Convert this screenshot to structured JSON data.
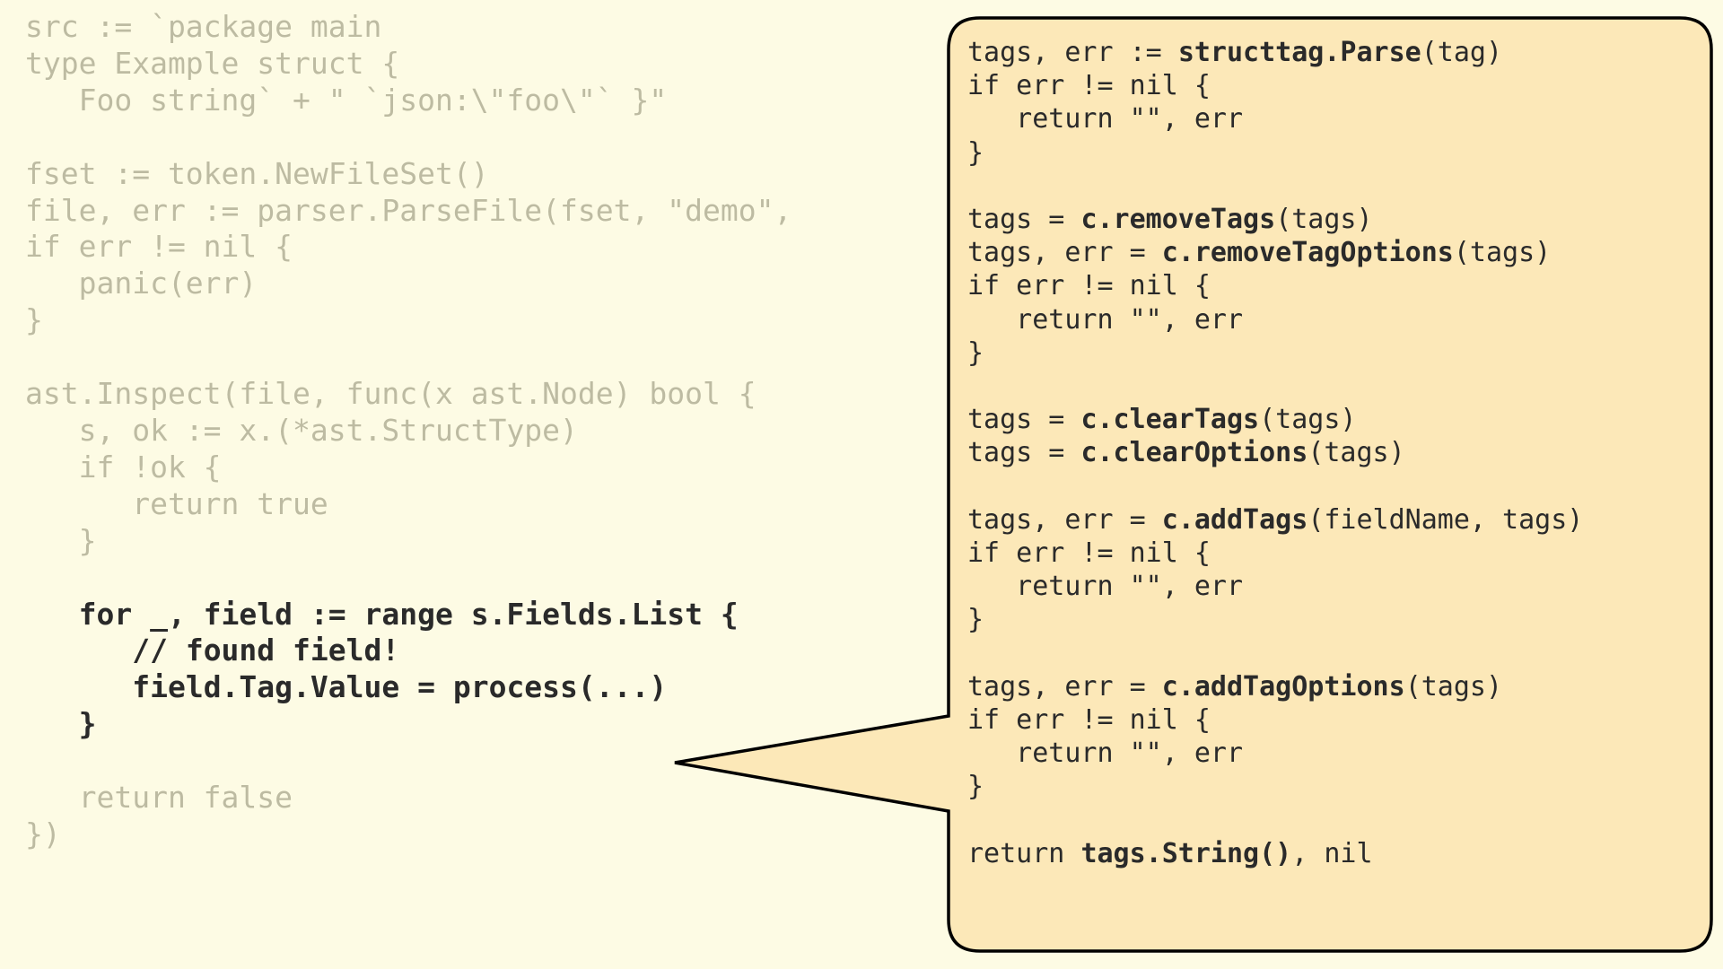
{
  "left": {
    "l01": "src := `package main",
    "l02": "type Example struct {",
    "l03": "   Foo string` + \" `json:\\\"foo\\\"` }\"",
    "l04": "",
    "l05": "fset := token.NewFileSet()",
    "l06": "file, err := parser.ParseFile(fset, \"demo\",",
    "l07": "if err != nil {",
    "l08": "   panic(err)",
    "l09": "}",
    "l10": "",
    "l11": "ast.Inspect(file, func(x ast.Node) bool {",
    "l12": "   s, ok := x.(*ast.StructType)",
    "l13": "   if !ok {",
    "l14": "      return true",
    "l15": "   }",
    "l16": "",
    "l17_pre": "   ",
    "l17_hl": "for _, field := range s.Fields.List {",
    "l18_pre": "      ",
    "l18_hl": "// found field!",
    "l19_pre": "      ",
    "l19_hl": "field.Tag.Value = process(...)",
    "l20_pre": "   ",
    "l20_hl": "}",
    "l21": "",
    "l22": "   return false",
    "l23": "})"
  },
  "right": {
    "r01a": "tags, err := ",
    "r01b": "structtag.Parse",
    "r01c": "(tag)",
    "r02": "if err != nil {",
    "r03": "   return \"\", err",
    "r04": "}",
    "r05": "",
    "r06a": "tags = ",
    "r06b": "c.removeTags",
    "r06c": "(tags)",
    "r07a": "tags, err = ",
    "r07b": "c.removeTagOptions",
    "r07c": "(tags)",
    "r08": "if err != nil {",
    "r09": "   return \"\", err",
    "r10": "}",
    "r11": "",
    "r12a": "tags = ",
    "r12b": "c.clearTags",
    "r12c": "(tags)",
    "r13a": "tags = ",
    "r13b": "c.clearOptions",
    "r13c": "(tags)",
    "r14": "",
    "r15a": "tags, err = ",
    "r15b": "c.addTags",
    "r15c": "(fieldName, tags)",
    "r16": "if err != nil {",
    "r17": "   return \"\", err",
    "r18": "}",
    "r19": "",
    "r20a": "tags, err = ",
    "r20b": "c.addTagOptions",
    "r20c": "(tags)",
    "r21": "if err != nil {",
    "r22": "   return \"\", err",
    "r23": "}",
    "r24": "",
    "r25a": "return ",
    "r25b": "tags.String()",
    "r25c": ", nil"
  }
}
